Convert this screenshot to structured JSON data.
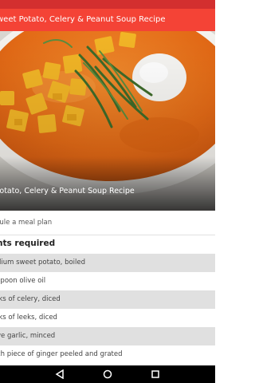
{
  "appbar": {
    "title": "weet Potato, Celery & Peanut Soup Recipe"
  },
  "hero": {
    "caption": "Potato, Celery & Peanut Soup Recipe"
  },
  "meal_plan": {
    "label": "dule a meal plan"
  },
  "ingredients": {
    "heading": "nts required",
    "items": [
      "dium sweet potato, boiled",
      "spoon olive oil",
      "lks of celery, diced",
      "lks of leeks, diced",
      "ve garlic, minced",
      "ch piece of ginger peeled and grated"
    ]
  },
  "colors": {
    "statusbar": "#d32f2f",
    "appbar": "#f44336",
    "soup": "#e8731f"
  },
  "nav": {
    "back_icon": "back-triangle-icon",
    "home_icon": "home-circle-icon",
    "recents_icon": "recents-square-icon"
  }
}
